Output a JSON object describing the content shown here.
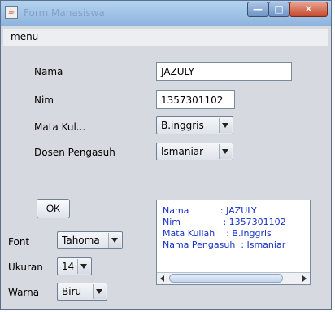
{
  "window": {
    "title": "Form Mahasiswa",
    "app_icon": "java-icon"
  },
  "titlebar_buttons": {
    "minimize": "—",
    "maximize": "□",
    "close": "✕"
  },
  "menu": {
    "label": "menu"
  },
  "form": {
    "nama_label": "Nama",
    "nama_value": "JAZULY",
    "nim_label": "Nim",
    "nim_value": "1357301102",
    "matkul_label": "Mata Kul...",
    "matkul_value": "B.inggris",
    "dosen_label": "Dosen Pengasuh",
    "dosen_value": "Ismaniar",
    "ok_label": "OK"
  },
  "settings": {
    "font_label": "Font",
    "font_value": "Tahoma",
    "ukuran_label": "Ukuran",
    "ukuran_value": "14",
    "warna_label": "Warna",
    "warna_value": "Biru"
  },
  "output": {
    "lines": [
      "Nama           : JAZULY",
      "Nim               : 1357301102",
      "Mata Kuliah    : B.inggris",
      "Nama Pengasuh  : Ismaniar"
    ],
    "text_color": "#1530c8"
  }
}
